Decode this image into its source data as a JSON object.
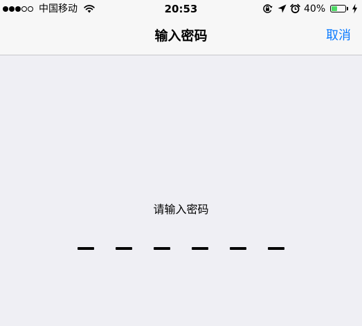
{
  "status_bar": {
    "signal_filled": 3,
    "signal_total": 5,
    "carrier": "中国移动",
    "time": "20:53",
    "battery_percent_text": "40%",
    "battery_level": 0.4,
    "battery_color": "#4cd964",
    "icons": [
      "signal-dots-icon",
      "wifi-icon",
      "rotation-lock-icon",
      "location-arrow-icon",
      "alarm-clock-icon",
      "battery-icon",
      "charging-bolt-icon"
    ]
  },
  "nav": {
    "title": "输入密码",
    "cancel_label": "取消",
    "accent_color": "#0a7aff"
  },
  "main": {
    "prompt": "请输入密码",
    "passcode_length": 6,
    "entered_digits": 0
  }
}
